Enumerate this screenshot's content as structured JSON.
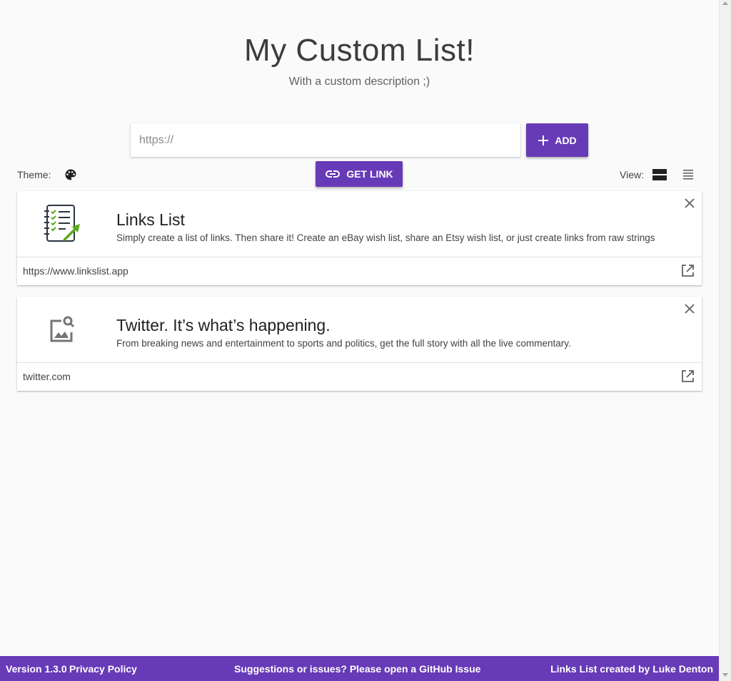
{
  "header": {
    "title": "My Custom List!",
    "subtitle": "With a custom description ;)"
  },
  "url_input": {
    "placeholder": "https://",
    "value": ""
  },
  "buttons": {
    "add_label": "ADD",
    "get_link_label": "GET LINK"
  },
  "controls": {
    "theme_label": "Theme:",
    "view_label": "View:",
    "active_view": "card-view"
  },
  "links": [
    {
      "title": "Links List",
      "description": "Simply create a list of links. Then share it! Create an eBay wish list, share an Etsy wish list, or just create links from raw strings",
      "url": "https://www.linkslist.app",
      "thumbnail": "checklist-logo"
    },
    {
      "title": "Twitter. It’s what’s happening.",
      "description": "From breaking news and entertainment to sports and politics, get the full story with all the live commentary.",
      "url": "twitter.com",
      "thumbnail": "image-search-placeholder-icon"
    }
  ],
  "footer": {
    "version": "Version 1.3.0",
    "privacy": "Privacy Policy",
    "suggestions": "Suggestions or issues? Please open a GitHub Issue",
    "credit": "Links List created by Luke Denton"
  },
  "colors": {
    "accent": "#673ab7",
    "background": "#fafafa"
  }
}
